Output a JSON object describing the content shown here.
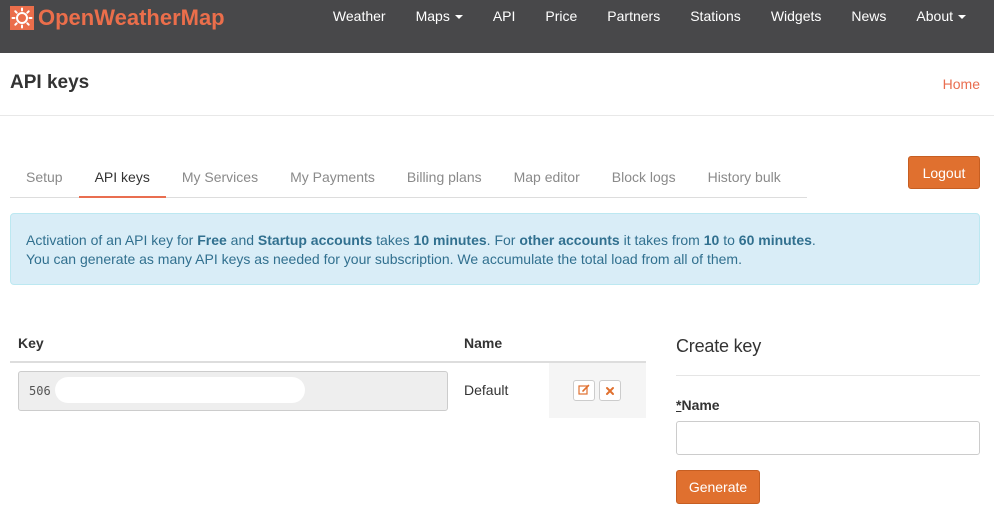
{
  "navbar": {
    "brand": "OpenWeatherMap",
    "brand_icon": "sun-logo-icon",
    "items": [
      {
        "label": "Weather",
        "dropdown": false
      },
      {
        "label": "Maps",
        "dropdown": true
      },
      {
        "label": "API",
        "dropdown": false
      },
      {
        "label": "Price",
        "dropdown": false
      },
      {
        "label": "Partners",
        "dropdown": false
      },
      {
        "label": "Stations",
        "dropdown": false
      },
      {
        "label": "Widgets",
        "dropdown": false
      },
      {
        "label": "News",
        "dropdown": false
      },
      {
        "label": "About",
        "dropdown": true
      }
    ]
  },
  "header": {
    "title": "API keys",
    "breadcrumb_home": "Home"
  },
  "tabs": [
    {
      "label": "Setup",
      "active": false
    },
    {
      "label": "API keys",
      "active": true
    },
    {
      "label": "My Services",
      "active": false
    },
    {
      "label": "My Payments",
      "active": false
    },
    {
      "label": "Billing plans",
      "active": false
    },
    {
      "label": "Map editor",
      "active": false
    },
    {
      "label": "Block logs",
      "active": false
    },
    {
      "label": "History bulk",
      "active": false
    }
  ],
  "logout_label": "Logout",
  "alert": {
    "line1": {
      "t1": "Activation of an API key for ",
      "b1": "Free",
      "t2": " and ",
      "b2": "Startup accounts",
      "t3": " takes ",
      "b3": "10 minutes",
      "t4": ". For ",
      "b4": "other accounts",
      "t5": " it takes from ",
      "b5": "10",
      "t6": " to ",
      "b6": "60 minutes",
      "t7": "."
    },
    "line2": "You can generate as many API keys as needed for your subscription. We accumulate the total load from all of them."
  },
  "keys_table": {
    "col_key": "Key",
    "col_name": "Name",
    "rows": [
      {
        "key_visible": "506",
        "name": "Default"
      }
    ]
  },
  "create_key": {
    "title": "Create key",
    "required_marker": "*",
    "name_label": "Name",
    "name_value": "",
    "generate_label": "Generate"
  },
  "colors": {
    "navbar_bg": "#48484a",
    "brand": "#eb6e4b",
    "accent_button": "#e0702f",
    "link": "#e96e50",
    "alert_bg": "#d9edf7",
    "alert_text": "#31708f"
  }
}
